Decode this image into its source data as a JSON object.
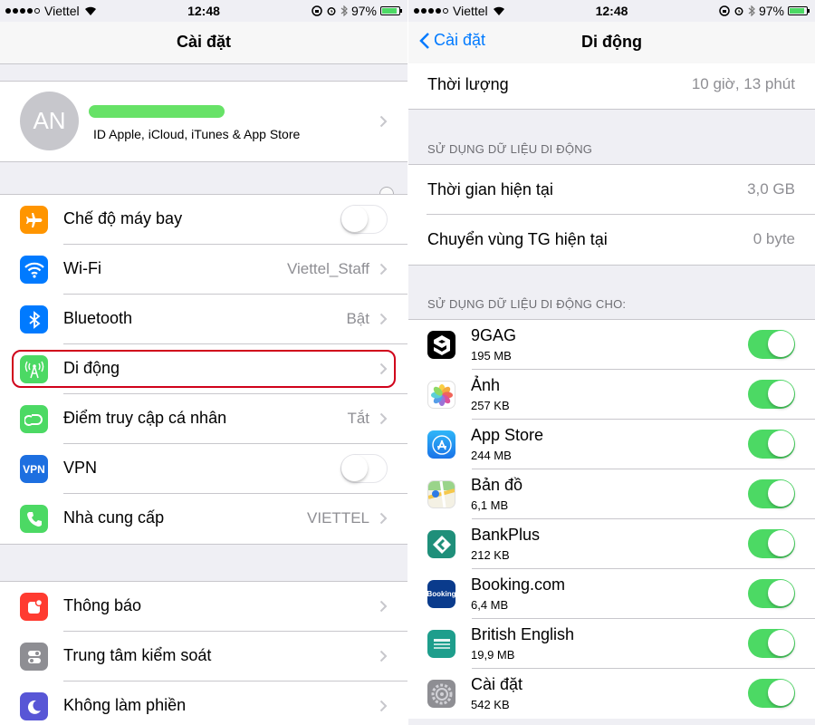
{
  "left": {
    "status": {
      "carrier": "Viettel",
      "time": "12:48",
      "battery": "97%"
    },
    "title": "Cài đặt",
    "profile": {
      "initials": "AN",
      "subtitle": "ID Apple, iCloud, iTunes & App Store"
    },
    "group1": [
      {
        "label": "Chế độ máy bay",
        "icon": "airplane-icon",
        "color": "#ff9500",
        "toggle": "off"
      },
      {
        "label": "Wi-Fi",
        "icon": "wifi-icon",
        "color": "#007aff",
        "value": "Viettel_Staff"
      },
      {
        "label": "Bluetooth",
        "icon": "bluetooth-icon",
        "color": "#007aff",
        "value": "Bật"
      },
      {
        "label": "Di động",
        "icon": "cellular-icon",
        "color": "#4cd964",
        "value": ""
      },
      {
        "label": "Điểm truy cập cá nhân",
        "icon": "hotspot-icon",
        "color": "#4cd964",
        "value": "Tắt"
      },
      {
        "label": "VPN",
        "icon": "vpn-icon",
        "color": "#007aff",
        "toggle": "off",
        "badge": "VPN"
      },
      {
        "label": "Nhà cung cấp",
        "icon": "phone-icon",
        "color": "#4cd964",
        "value": "VIETTEL"
      }
    ],
    "group2": [
      {
        "label": "Thông báo",
        "icon": "notifications-icon",
        "color": "#ff3b30"
      },
      {
        "label": "Trung tâm kiểm soát",
        "icon": "control-center-icon",
        "color": "#8e8e93"
      },
      {
        "label": "Không làm phiền",
        "icon": "moon-icon",
        "color": "#5856d6"
      }
    ]
  },
  "right": {
    "status": {
      "carrier": "Viettel",
      "time": "12:48",
      "battery": "97%"
    },
    "back_label": "Cài đặt",
    "title": "Di động",
    "duration": {
      "label": "Thời lượng",
      "value": "10 giờ, 13 phút"
    },
    "usage_header": "SỬ DỤNG DỮ LIỆU DI ĐỘNG",
    "usage": [
      {
        "label": "Thời gian hiện tại",
        "value": "3,0 GB"
      },
      {
        "label": "Chuyển vùng TG hiện tại",
        "value": "0 byte"
      }
    ],
    "apps_header": "SỬ DỤNG DỮ LIỆU DI ĐỘNG CHO:",
    "apps": [
      {
        "name": "9GAG",
        "size": "195 MB",
        "icon": "9gag-icon",
        "enabled": true
      },
      {
        "name": "Ảnh",
        "size": "257 KB",
        "icon": "photos-icon",
        "enabled": true
      },
      {
        "name": "App Store",
        "size": "244 MB",
        "icon": "app-store-icon",
        "enabled": true
      },
      {
        "name": "Bản đồ",
        "size": "6,1 MB",
        "icon": "maps-icon",
        "enabled": true
      },
      {
        "name": "BankPlus",
        "size": "212 KB",
        "icon": "bankplus-icon",
        "enabled": true
      },
      {
        "name": "Booking.com",
        "size": "6,4 MB",
        "icon": "booking-icon",
        "badge": "Booking",
        "enabled": true
      },
      {
        "name": "British English",
        "size": "19,9 MB",
        "icon": "british-english-icon",
        "enabled": true
      },
      {
        "name": "Cài đặt",
        "size": "542 KB",
        "icon": "settings-icon",
        "enabled": true
      }
    ]
  }
}
